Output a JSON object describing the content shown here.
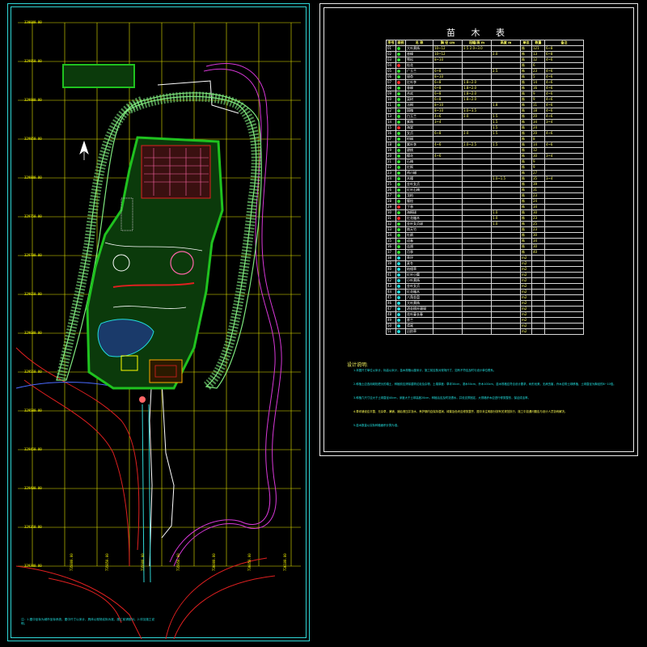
{
  "schedule": {
    "title": "苗 木 表",
    "headers": [
      "序号",
      "图例",
      "名 称",
      "胸 径 cm",
      "冠幅/高 m",
      "高度 m",
      "单位",
      "数量",
      "备注"
    ],
    "rows": [
      [
        "01",
        "green",
        "大叶黄杨",
        "10~12",
        "2.5 2.0~3.0",
        "",
        "株",
        "121",
        "6~8"
      ],
      [
        "02",
        "green",
        "香樟",
        "10~12",
        "",
        "2.0",
        "株",
        "13",
        "6~8"
      ],
      [
        "03",
        "green",
        "雪松",
        "8~10",
        "",
        "",
        "株",
        "12",
        "4~6"
      ],
      [
        "04",
        "red",
        "桂花",
        "",
        "",
        "",
        "株",
        "6",
        ""
      ],
      [
        "05",
        "green",
        "广玉兰",
        "6~8",
        "",
        "2.5",
        "株",
        "23",
        "4~6"
      ],
      [
        "06",
        "green",
        "银杏",
        "8~10",
        "",
        "",
        "株",
        "5",
        "4~6"
      ],
      [
        "07",
        "red",
        "红叶李",
        "6~8",
        "1.8~2.0",
        "",
        "株",
        "14",
        "4~6"
      ],
      [
        "08",
        "green",
        "垂柳",
        "6~8",
        "1.8~2.0",
        "",
        "株",
        "16",
        "4~6"
      ],
      [
        "09",
        "green",
        "合欢",
        "6~8",
        "1.8~2.0",
        "",
        "株",
        "9",
        "4~6"
      ],
      [
        "10",
        "green",
        "栾树",
        "6~8",
        "1.8~2.0",
        "",
        "株",
        "9",
        "4~6"
      ],
      [
        "11",
        "green",
        "法桐",
        "8~10",
        "",
        "1.8",
        "株",
        "11",
        "4~6"
      ],
      [
        "12",
        "green",
        "国槐",
        "8~10",
        "3.0~3.5",
        "",
        "株",
        "18",
        "4~6"
      ],
      [
        "13",
        "green",
        "白玉兰",
        "4~6",
        "2.0",
        "1.5",
        "株",
        "20",
        "4~6"
      ],
      [
        "14",
        "green",
        "紫薇",
        "3~4",
        "",
        "1.5",
        "株",
        "34",
        "3~4"
      ],
      [
        "15",
        "red",
        "海棠",
        "",
        "",
        "1.5",
        "株",
        "24",
        ""
      ],
      [
        "16",
        "green",
        "女贞",
        "6~8",
        "2.0",
        "1.5",
        "株",
        "20",
        "4~6"
      ],
      [
        "17",
        "green",
        "棕榈",
        "",
        "",
        "",
        "株",
        "8",
        ""
      ],
      [
        "18",
        "green",
        "紫叶李",
        "4~6",
        "2.0~2.5",
        "1.5",
        "株",
        "14",
        "4~6"
      ],
      [
        "19",
        "green",
        "碧桃",
        "",
        "",
        "",
        "株",
        "12",
        ""
      ],
      [
        "20",
        "green",
        "樱花",
        "4~6",
        "",
        "",
        "株",
        "30",
        "3~4"
      ],
      [
        "21",
        "green",
        "石楠",
        "",
        "",
        "",
        "株",
        "9",
        ""
      ],
      [
        "22",
        "green",
        "红枫",
        "",
        "",
        "",
        "株",
        "9",
        ""
      ],
      [
        "23",
        "green",
        "鸡爪槭",
        "",
        "",
        "",
        "株",
        "27",
        ""
      ],
      [
        "24",
        "green",
        "木槿",
        "",
        "",
        "1.0~1.5",
        "株",
        "35",
        "3~4"
      ],
      [
        "25",
        "green",
        "金叶女贞",
        "",
        "",
        "",
        "株",
        "39",
        ""
      ],
      [
        "26",
        "green",
        "红叶石楠",
        "",
        "",
        "",
        "株",
        "31",
        ""
      ],
      [
        "27",
        "green",
        "龙柏",
        "",
        "",
        "",
        "株",
        "23",
        ""
      ],
      [
        "28",
        "green",
        "蜀桧",
        "",
        "",
        "",
        "株",
        "24",
        ""
      ],
      [
        "29",
        "red",
        "丁香",
        "",
        "",
        "",
        "株",
        "34",
        ""
      ],
      [
        "30",
        "green",
        "海桐球",
        "",
        "",
        "1.0",
        "株",
        "30",
        ""
      ],
      [
        "31",
        "red",
        "红花檵木",
        "",
        "",
        "1.0",
        "株",
        "23",
        ""
      ],
      [
        "32",
        "green",
        "金叶女贞球",
        "",
        "",
        "1.0",
        "株",
        "25",
        ""
      ],
      [
        "33",
        "green",
        "南天竹",
        "",
        "",
        "",
        "株",
        "23",
        ""
      ],
      [
        "34",
        "green",
        "杜鹃",
        "",
        "",
        "",
        "株",
        "30",
        ""
      ],
      [
        "35",
        "green",
        "迎春",
        "",
        "",
        "",
        "株",
        "34",
        ""
      ],
      [
        "36",
        "green",
        "连翘",
        "",
        "",
        "",
        "株",
        "30",
        ""
      ],
      [
        "37",
        "green",
        "月季",
        "",
        "",
        "",
        "株",
        "40",
        ""
      ],
      [
        "38",
        "cyan",
        "草坪",
        "",
        "",
        "",
        "m2",
        "",
        ""
      ],
      [
        "39",
        "cyan",
        "麦冬",
        "",
        "",
        "",
        "m2",
        "",
        ""
      ],
      [
        "40",
        "cyan",
        "结缕草",
        "",
        "",
        "",
        "m2",
        "",
        ""
      ],
      [
        "41",
        "cyan",
        "红叶小檗",
        "",
        "",
        "",
        "m2",
        "",
        ""
      ],
      [
        "42",
        "cyan",
        "小叶黄杨",
        "",
        "",
        "",
        "m2",
        "",
        ""
      ],
      [
        "43",
        "cyan",
        "金叶女贞",
        "",
        "",
        "",
        "m2",
        "",
        ""
      ],
      [
        "44",
        "cyan",
        "红花檵木",
        "",
        "",
        "",
        "m2",
        "",
        ""
      ],
      [
        "45",
        "cyan",
        "八角金盘",
        "",
        "",
        "",
        "m2",
        "",
        ""
      ],
      [
        "46",
        "cyan",
        "大叶黄杨",
        "",
        "",
        "",
        "m2",
        "",
        ""
      ],
      [
        "47",
        "cyan",
        "洒金桃叶珊瑚",
        "",
        "",
        "",
        "m2",
        "",
        ""
      ],
      [
        "48",
        "cyan",
        "花叶蔓长春",
        "",
        "",
        "",
        "m2",
        "",
        ""
      ],
      [
        "49",
        "cyan",
        "葱兰",
        "",
        "",
        "",
        "m2",
        "",
        ""
      ],
      [
        "50",
        "cyan",
        "鸢尾",
        "",
        "",
        "",
        "m2",
        "",
        ""
      ],
      [
        "51",
        "cyan",
        "沿阶草",
        "",
        "",
        "",
        "m2",
        "",
        ""
      ]
    ]
  },
  "notes": {
    "heading": "设计说明:",
    "paragraphs": [
      "1.本图尺寸单位以米计，标高以米计，苗木规格以厘米计，施工前应核对现场尺寸，如有不符应及时与设计单位联系。",
      "2.种植土应选用疏松肥沃的壤土，种植前应清除建筑垃圾及杂物，土壤厚度：草坪30cm，灌木50cm，乔木100cm，苗木规格应符合设计要求，树形优美，无病虫害，乔木应带土球移植，土球直径为胸径的8~10倍。",
      "3.种植穴尺寸应大于土球直径40cm，深度大于土球高度20cm，种植后应及时浇透水，并设支撑固定，大规格乔木应进行修剪整形，保证成活率。",
      "4.草坪铺设应平整，无杂草，满铺，铺后滚压并浇水，养护期内应保持湿润，绿篱及色块应修剪整齐，图中未注明部分按有关规范执行，施工中如遇问题应与设计人员协商解决。",
      "5.苗木数量以实际种植面积计算为准。"
    ]
  },
  "plan": {
    "y_coords": [
      "330000.00",
      "329950.00",
      "329900.00",
      "329850.00",
      "329800.00",
      "329750.00",
      "329700.00",
      "329650.00",
      "329600.00",
      "329550.00",
      "329500.00",
      "329450.00",
      "329400.00",
      "329350.00",
      "329300.00"
    ],
    "x_coords": [
      "735800.00",
      "735850.00",
      "735900.00",
      "735950.00",
      "736000.00",
      "736050.00",
      "736100.00"
    ],
    "bottom_note": "注：1.图中坐标为城市坐标系统，图中尺寸以米计，具体以现场实际为准，施工前请核对。2.详见施工说明。"
  },
  "colors": {
    "frame": "#2fd6d6",
    "grid": "#ffff00",
    "green_belt": "#7ee87e",
    "park_fill": "#1fc21f",
    "road_magenta": "#d838d8",
    "road_red": "#e02020",
    "white_line": "#ffffff"
  }
}
